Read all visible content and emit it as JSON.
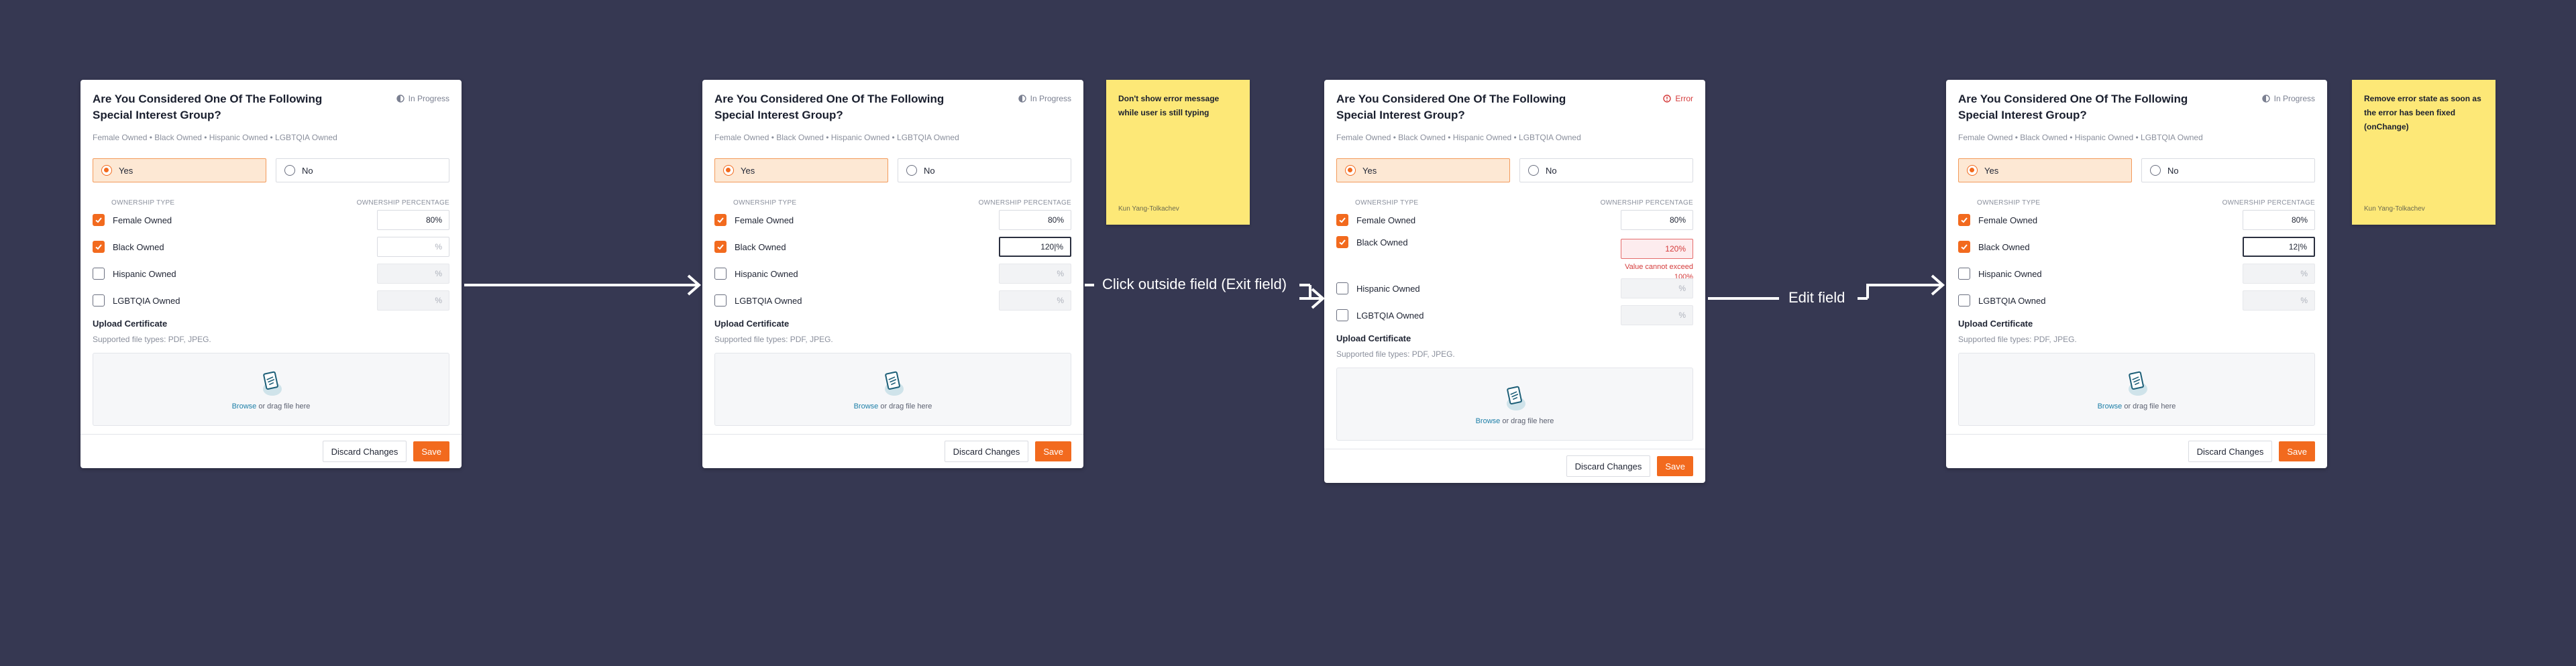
{
  "colors": {
    "background": "#363852",
    "accent": "#f26a1e",
    "error": "#d43b3b",
    "note": "#fde877"
  },
  "card1": {
    "title": "Are You Considered One Of The Following Special Interest Group?",
    "status": "In Progress",
    "subtitle": "Female Owned • Black Owned • Hispanic Owned • LGBTQIA Owned",
    "yes": "Yes",
    "no": "No",
    "col_type": "OWNERSHIP TYPE",
    "col_pct": "OWNERSHIP PERCENTAGE",
    "rows": [
      {
        "label": "Female Owned",
        "value": "80%",
        "checked": true
      },
      {
        "label": "Black Owned",
        "value": "%",
        "checked": true
      },
      {
        "label": "Hispanic Owned",
        "value": "%",
        "checked": false
      },
      {
        "label": "LGBTQIA Owned",
        "value": "%",
        "checked": false
      }
    ],
    "upload_title": "Upload Certificate",
    "upload_sub": "Supported file types: PDF, JPEG.",
    "browse": "Browse",
    "drag": " or drag file here",
    "discard": "Discard Changes",
    "save": "Save"
  },
  "card2": {
    "title": "Are You Considered One Of The Following Special Interest Group?",
    "status": "In Progress",
    "subtitle": "Female Owned • Black Owned • Hispanic Owned • LGBTQIA Owned",
    "yes": "Yes",
    "no": "No",
    "col_type": "OWNERSHIP TYPE",
    "col_pct": "OWNERSHIP PERCENTAGE",
    "rows": [
      {
        "label": "Female Owned",
        "value": "80%",
        "checked": true
      },
      {
        "label": "Black Owned",
        "value": "120|%",
        "checked": true
      },
      {
        "label": "Hispanic Owned",
        "value": "%",
        "checked": false
      },
      {
        "label": "LGBTQIA Owned",
        "value": "%",
        "checked": false
      }
    ],
    "upload_title": "Upload Certificate",
    "upload_sub": "Supported file types: PDF, JPEG.",
    "browse": "Browse",
    "drag": " or drag file here",
    "discard": "Discard Changes",
    "save": "Save"
  },
  "card3": {
    "title": "Are You Considered One Of The Following Special Interest Group?",
    "status": "Error",
    "subtitle": "Female Owned • Black Owned • Hispanic Owned • LGBTQIA Owned",
    "yes": "Yes",
    "no": "No",
    "col_type": "OWNERSHIP TYPE",
    "col_pct": "OWNERSHIP PERCENTAGE",
    "rows": [
      {
        "label": "Female Owned",
        "value": "80%",
        "checked": true
      },
      {
        "label": "Black Owned",
        "value": "120%",
        "checked": true
      },
      {
        "label": "Hispanic Owned",
        "value": "%",
        "checked": false
      },
      {
        "label": "LGBTQIA Owned",
        "value": "%",
        "checked": false
      }
    ],
    "error_msg": "Value cannot exceed 100%",
    "upload_title": "Upload Certificate",
    "upload_sub": "Supported file types: PDF, JPEG.",
    "browse": "Browse",
    "drag": " or drag file here",
    "discard": "Discard Changes",
    "save": "Save"
  },
  "card4": {
    "title": "Are You Considered One Of The Following Special Interest Group?",
    "status": "In Progress",
    "subtitle": "Female Owned • Black Owned • Hispanic Owned • LGBTQIA Owned",
    "yes": "Yes",
    "no": "No",
    "col_type": "OWNERSHIP TYPE",
    "col_pct": "OWNERSHIP PERCENTAGE",
    "rows": [
      {
        "label": "Female Owned",
        "value": "80%",
        "checked": true
      },
      {
        "label": "Black Owned",
        "value": "12|%",
        "checked": true
      },
      {
        "label": "Hispanic Owned",
        "value": "%",
        "checked": false
      },
      {
        "label": "LGBTQIA Owned",
        "value": "%",
        "checked": false
      }
    ],
    "upload_title": "Upload Certificate",
    "upload_sub": "Supported file types: PDF, JPEG.",
    "browse": "Browse",
    "drag": " or drag file here",
    "discard": "Discard Changes",
    "save": "Save"
  },
  "note1": {
    "text": "Don't show error message while user is still typing",
    "author": "Kun Yang-Tolkachev"
  },
  "note2": {
    "text": "Remove error state as soon as the error has been fixed (onChange)",
    "author": "Kun Yang-Tolkachev"
  },
  "flow": {
    "label1": "Click outside field (Exit field)",
    "label2": "Edit field"
  }
}
